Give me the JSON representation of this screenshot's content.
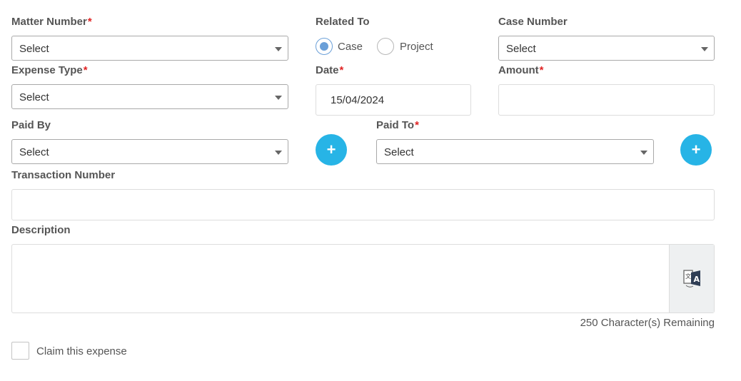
{
  "form": {
    "matter_number": {
      "label": "Matter Number",
      "required": "*",
      "value": "Select"
    },
    "related_to": {
      "label": "Related To",
      "options": [
        {
          "label": "Case",
          "selected": true
        },
        {
          "label": "Project",
          "selected": false
        }
      ]
    },
    "case_number": {
      "label": "Case Number",
      "value": "Select"
    },
    "expense_type": {
      "label": "Expense Type",
      "required": "*",
      "value": "Select"
    },
    "date": {
      "label": "Date",
      "required": "*",
      "value": "15/04/2024"
    },
    "amount": {
      "label": "Amount",
      "required": "*",
      "value": ""
    },
    "paid_by": {
      "label": "Paid By",
      "value": "Select",
      "add_label": "+"
    },
    "paid_to": {
      "label": "Paid To",
      "required": "*",
      "value": "Select",
      "add_label": "+"
    },
    "transaction_number": {
      "label": "Transaction Number",
      "value": ""
    },
    "description": {
      "label": "Description",
      "value": "",
      "remaining": "250 Character(s) Remaining",
      "translate_icon": "translate-icon"
    },
    "claim": {
      "label": "Claim this expense",
      "checked": false
    }
  },
  "colors": {
    "accent": "#27b4e6",
    "required": "#e02424",
    "radio": "#6a9fd8"
  }
}
